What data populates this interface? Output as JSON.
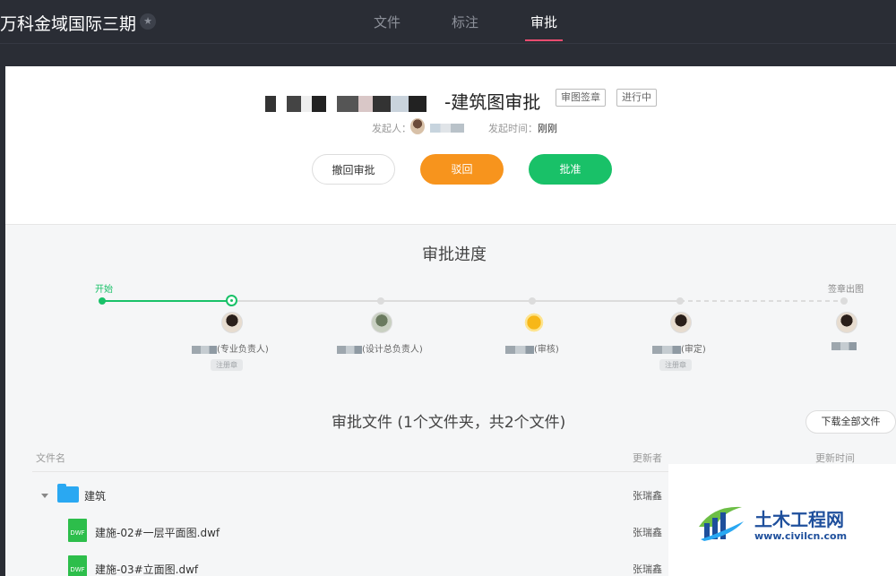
{
  "topbar": {
    "project_title": "万科金域国际三期",
    "tabs": [
      {
        "label": "文件"
      },
      {
        "label": "标注"
      },
      {
        "label": "审批"
      }
    ]
  },
  "doc": {
    "title_suffix": "-建筑图审批",
    "tag": "审图签章",
    "status": "进行中",
    "initiator_label": "发起人：",
    "time_label": "发起时间：",
    "time_value": "刚刚"
  },
  "actions": {
    "withdraw": "撤回审批",
    "reject": "驳回",
    "approve": "批准"
  },
  "progress": {
    "title": "审批进度",
    "start": "开始",
    "end": "签章出图",
    "steps": [
      {
        "role": "(专业负责人)",
        "chip": "注册章"
      },
      {
        "role": "(设计总负责人)"
      },
      {
        "role": "(审核)"
      },
      {
        "role": "(审定)",
        "chip": "注册章"
      }
    ]
  },
  "files": {
    "title": "审批文件 (1个文件夹，共2个文件)",
    "download_all": "下载全部文件",
    "col_name": "文件名",
    "col_updater": "更新者",
    "col_updated": "更新时间",
    "rows": [
      {
        "name": "建筑",
        "updater": "张瑞鑫",
        "type": "folder"
      },
      {
        "name": "建施-02#一层平面图.dwf",
        "updater": "张瑞鑫",
        "type": "DWF"
      },
      {
        "name": "建施-03#立面图.dwf",
        "updater": "张瑞鑫",
        "type": "DWF"
      }
    ]
  },
  "watermark": {
    "name": "土木工程网",
    "url": "www.civilcn.com"
  }
}
